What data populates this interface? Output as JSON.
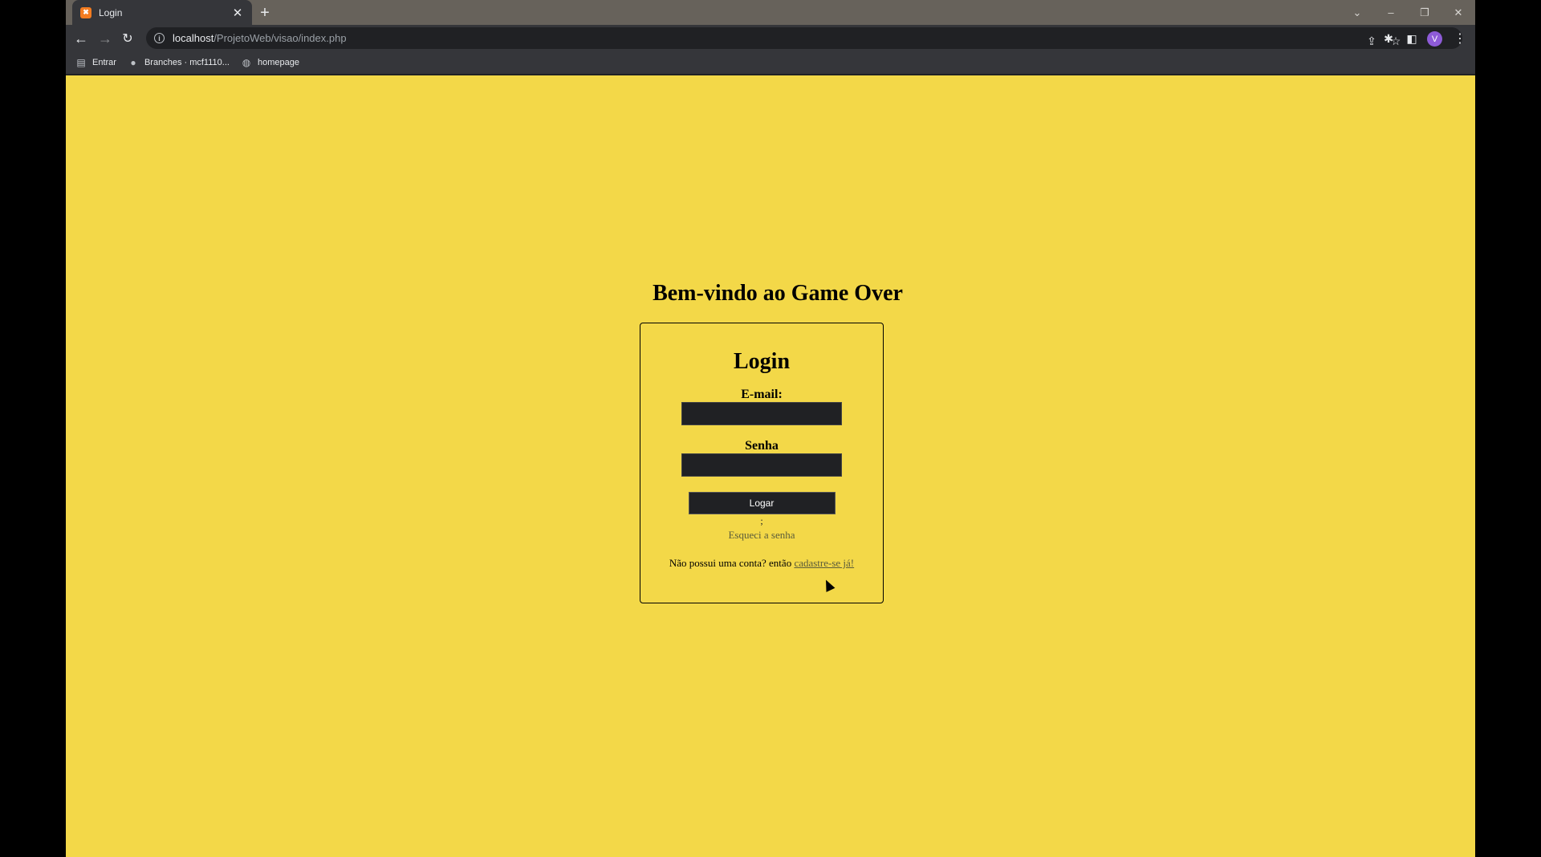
{
  "browser": {
    "tab": {
      "title": "Login",
      "favicon": "xampp-icon"
    },
    "address": {
      "host": "localhost",
      "path": "/ProjetoWeb/visao/index.php"
    },
    "profile_initial": "V",
    "bookmarks": [
      {
        "label": "Entrar",
        "icon": "bookmark-page-icon"
      },
      {
        "label": "Branches · mcf1110...",
        "icon": "github-icon"
      },
      {
        "label": "homepage",
        "icon": "globe-icon"
      }
    ]
  },
  "page": {
    "background": "#f3d848",
    "heading": "Bem-vindo ao Game Over",
    "login": {
      "title": "Login",
      "email_label": "E-mail:",
      "password_label": "Senha",
      "submit_label": "Logar",
      "separator": ";",
      "forgot_link": "Esqueci a senha",
      "signup_prefix": "Não possui uma conta? então ",
      "signup_link": "cadastre-se já!"
    }
  }
}
